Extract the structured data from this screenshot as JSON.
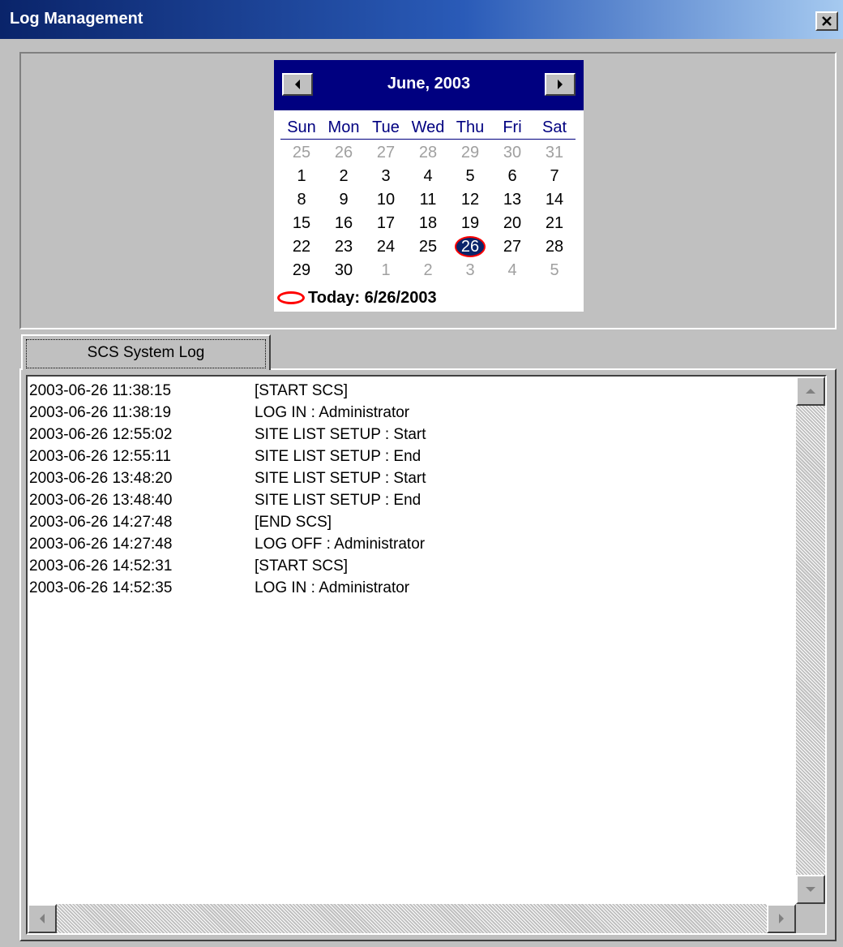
{
  "window": {
    "title": "Log Management"
  },
  "calendar": {
    "month_label": "June, 2003",
    "days_of_week": [
      "Sun",
      "Mon",
      "Tue",
      "Wed",
      "Thu",
      "Fri",
      "Sat"
    ],
    "days": [
      [
        "25",
        "other"
      ],
      [
        "26",
        "other"
      ],
      [
        "27",
        "other"
      ],
      [
        "28",
        "other"
      ],
      [
        "29",
        "other"
      ],
      [
        "30",
        "other"
      ],
      [
        "31",
        "other"
      ],
      [
        "1",
        ""
      ],
      [
        "2",
        ""
      ],
      [
        "3",
        ""
      ],
      [
        "4",
        ""
      ],
      [
        "5",
        ""
      ],
      [
        "6",
        ""
      ],
      [
        "7",
        ""
      ],
      [
        "8",
        ""
      ],
      [
        "9",
        ""
      ],
      [
        "10",
        ""
      ],
      [
        "11",
        ""
      ],
      [
        "12",
        ""
      ],
      [
        "13",
        ""
      ],
      [
        "14",
        ""
      ],
      [
        "15",
        ""
      ],
      [
        "16",
        ""
      ],
      [
        "17",
        ""
      ],
      [
        "18",
        ""
      ],
      [
        "19",
        ""
      ],
      [
        "20",
        ""
      ],
      [
        "21",
        ""
      ],
      [
        "22",
        ""
      ],
      [
        "23",
        ""
      ],
      [
        "24",
        ""
      ],
      [
        "25",
        ""
      ],
      [
        "26",
        "sel"
      ],
      [
        "27",
        ""
      ],
      [
        "28",
        ""
      ],
      [
        "29",
        ""
      ],
      [
        "30",
        ""
      ],
      [
        "1",
        "other"
      ],
      [
        "2",
        "other"
      ],
      [
        "3",
        "other"
      ],
      [
        "4",
        "other"
      ],
      [
        "5",
        "other"
      ]
    ],
    "today_label": "Today: 6/26/2003"
  },
  "tabs": [
    {
      "label": "SCS System Log"
    }
  ],
  "log": {
    "rows": [
      {
        "time": "2003-06-26 11:38:15",
        "message": "[START SCS]"
      },
      {
        "time": "2003-06-26 11:38:19",
        "message": "LOG IN : Administrator"
      },
      {
        "time": "2003-06-26 12:55:02",
        "message": "SITE LIST SETUP : Start"
      },
      {
        "time": "2003-06-26 12:55:11",
        "message": "SITE LIST SETUP : End"
      },
      {
        "time": "2003-06-26 13:48:20",
        "message": "SITE LIST SETUP : Start"
      },
      {
        "time": "2003-06-26 13:48:40",
        "message": "SITE LIST SETUP : End"
      },
      {
        "time": "2003-06-26 14:27:48",
        "message": "[END SCS]"
      },
      {
        "time": "2003-06-26 14:27:48",
        "message": "LOG OFF : Administrator"
      },
      {
        "time": "2003-06-26 14:52:31",
        "message": "[START SCS]"
      },
      {
        "time": "2003-06-26 14:52:35",
        "message": "LOG IN : Administrator"
      }
    ]
  },
  "icons": {
    "close": "close-icon",
    "prev": "triangle-left-icon",
    "next": "triangle-right-icon",
    "scroll_up": "triangle-up-icon",
    "scroll_down": "triangle-down-icon",
    "scroll_left": "triangle-left-icon",
    "scroll_right": "triangle-right-icon"
  },
  "colors": {
    "title_bar": "#0a246a",
    "calendar_header": "#000080",
    "today_marker": "#ff0000",
    "face": "#c0c0c0"
  }
}
